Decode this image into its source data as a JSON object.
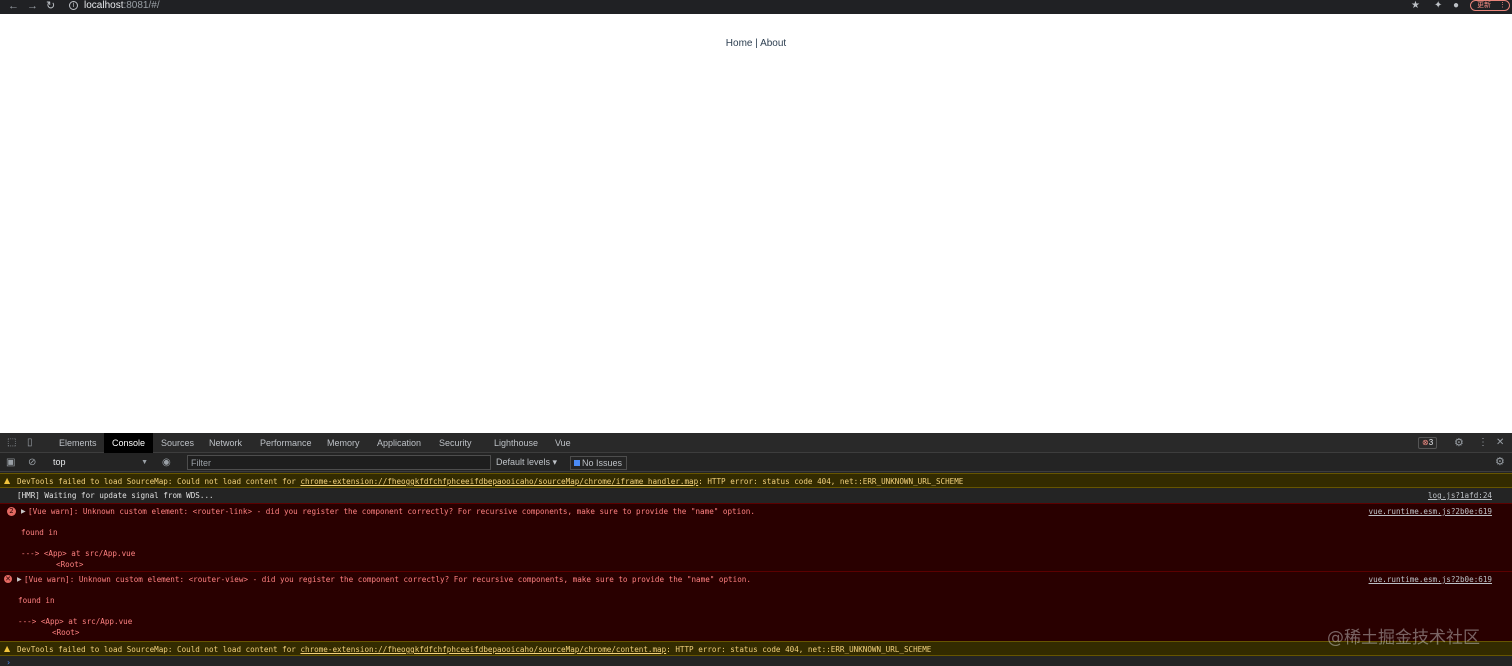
{
  "browser": {
    "url_host": "localhost",
    "url_rest": ":8081/#/",
    "update_label": "更新"
  },
  "page": {
    "nav_home": "Home",
    "nav_sep": " | ",
    "nav_about": "About"
  },
  "devtools": {
    "tabs": [
      "Elements",
      "Console",
      "Sources",
      "Network",
      "Performance",
      "Memory",
      "Application",
      "Security",
      "Lighthouse",
      "Vue"
    ],
    "active_tab": "Console",
    "error_count": "3",
    "context": "top",
    "filter_placeholder": "Filter",
    "levels": "Default levels",
    "issues": "No Issues"
  },
  "console": {
    "warn1": {
      "pre": "DevTools failed to load SourceMap: Could not load content for ",
      "link": "chrome-extension://fheoggkfdfchfphceeifdbepaooicaho/sourceMap/chrome/iframe_handler.map",
      "post": ": HTTP error: status code 404, net::ERR_UNKNOWN_URL_SCHEME"
    },
    "info1": {
      "text": "[HMR] Waiting for update signal from WDS...",
      "source": "log.js?1afd:24"
    },
    "error1": {
      "count": "2",
      "text": "[Vue warn]: Unknown custom element: <router-link> - did you register the component correctly? For recursive components, make sure to provide the \"name\" option.",
      "found": "found in",
      "trace1": "---> <App> at src/App.vue",
      "trace2": "<Root>",
      "source": "vue.runtime.esm.js?2b0e:619"
    },
    "error2": {
      "text": "[Vue warn]: Unknown custom element: <router-view> - did you register the component correctly? For recursive components, make sure to provide the \"name\" option.",
      "found": "found in",
      "trace1": "---> <App> at src/App.vue",
      "trace2": "<Root>",
      "source": "vue.runtime.esm.js?2b0e:619"
    },
    "warn2": {
      "pre": "DevTools failed to load SourceMap: Could not load content for ",
      "link": "chrome-extension://fheoggkfdfchfphceeifdbepaooicaho/sourceMap/chrome/content.map",
      "post": ": HTTP error: status code 404, net::ERR_UNKNOWN_URL_SCHEME"
    }
  },
  "watermark": "@稀土掘金技术社区"
}
